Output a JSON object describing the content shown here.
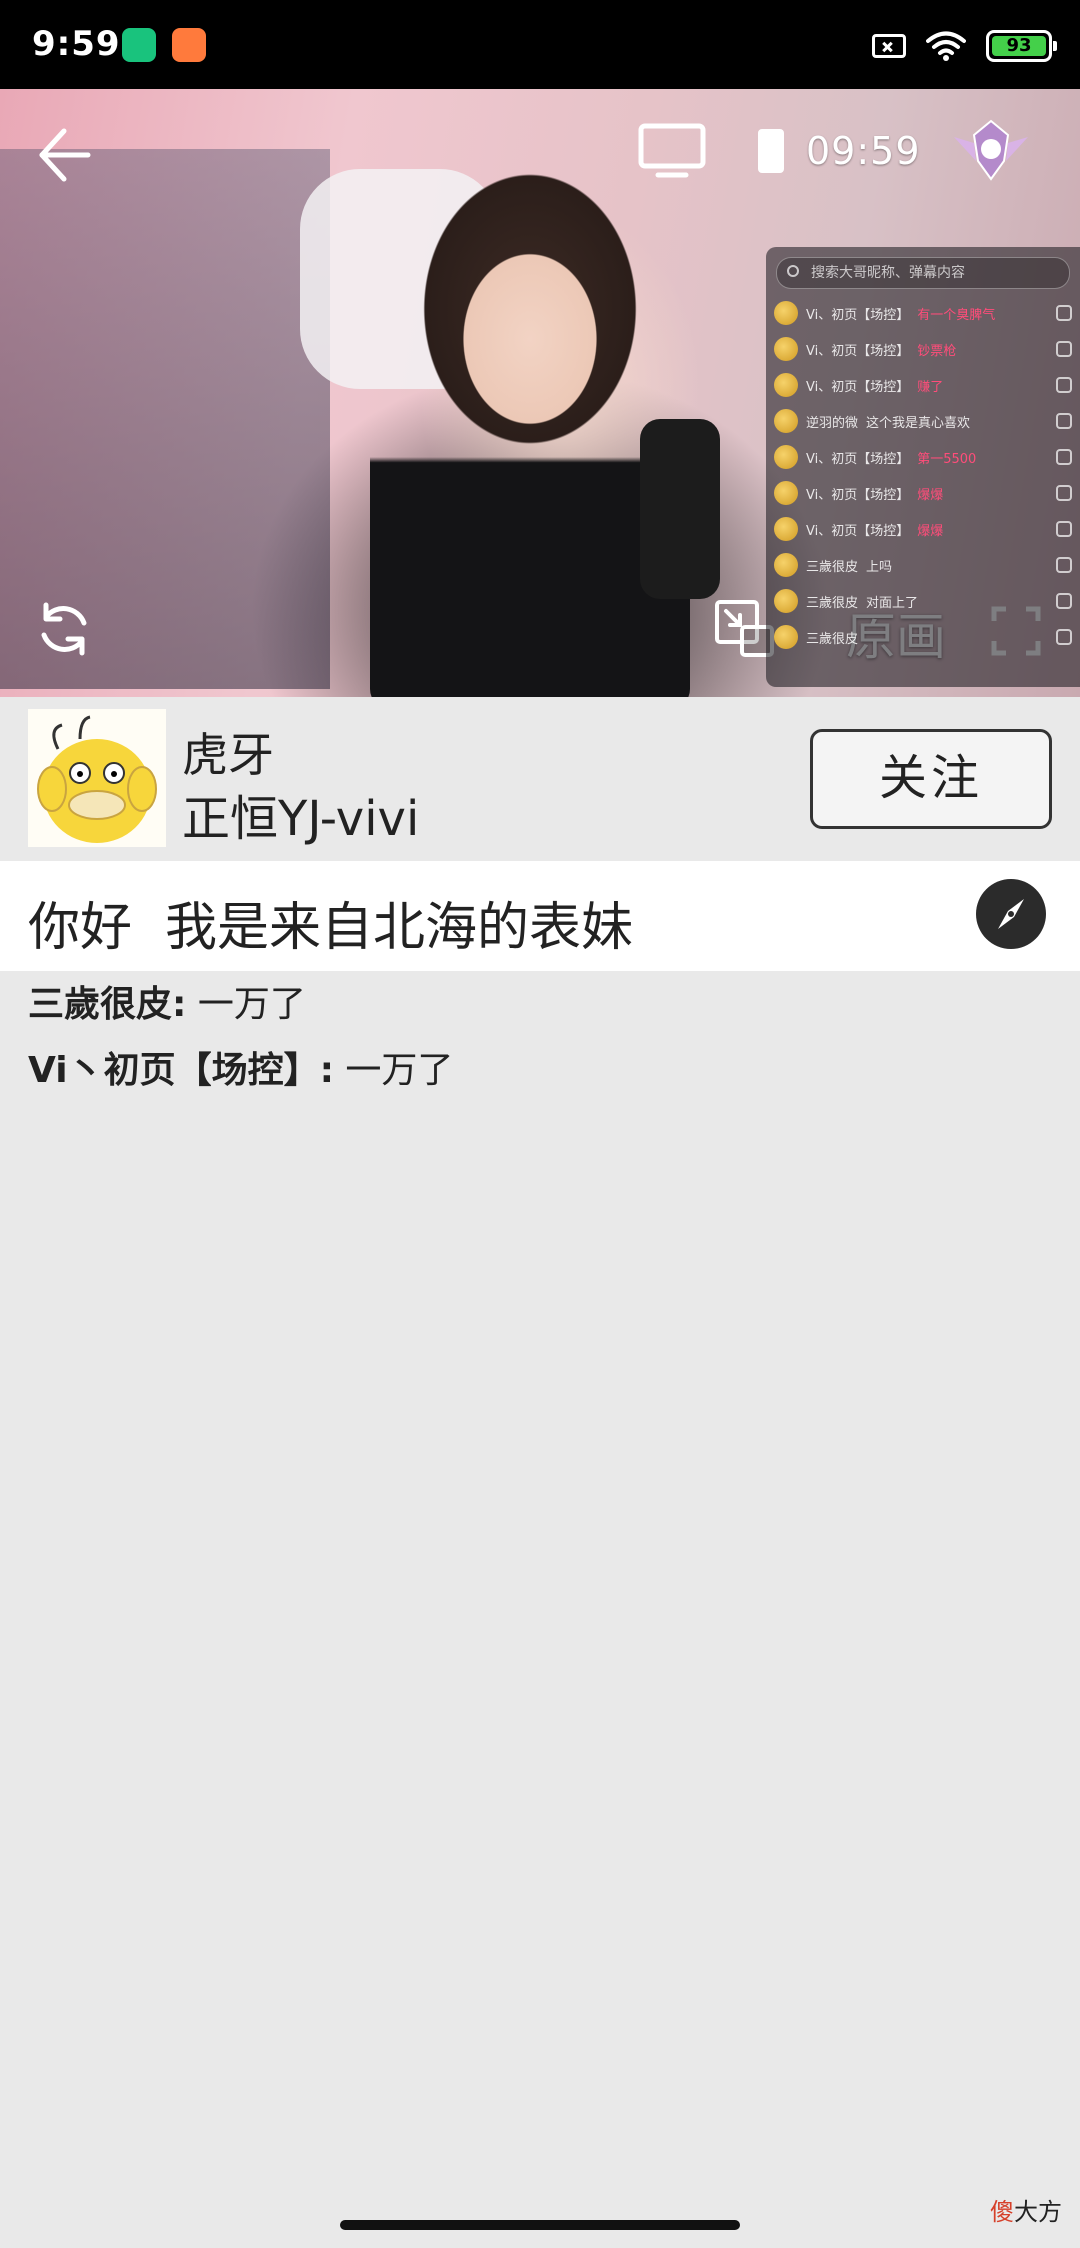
{
  "status_bar": {
    "time": "9:59",
    "battery_level": "93",
    "app_icons": [
      "shield-app-icon",
      "shop-app-icon"
    ]
  },
  "video": {
    "clock": "09:59",
    "quality_label": "原画",
    "danmaku_panel": {
      "search_placeholder": "搜索大哥昵称、弹幕内容",
      "messages": [
        {
          "user": "Vi、初页【场控】",
          "text": "有一个臭脾气",
          "style": "highlight"
        },
        {
          "user": "Vi、初页【场控】",
          "text": "钞票枪",
          "style": "highlight"
        },
        {
          "user": "Vi、初页【场控】",
          "text": "赚了",
          "style": "highlight"
        },
        {
          "user": "逆羽的微",
          "text": "这个我是真心喜欢",
          "style": "plain"
        },
        {
          "user": "Vi、初页【场控】",
          "text": "第一5500",
          "style": "highlight"
        },
        {
          "user": "Vi、初页【场控】",
          "text": "爆爆",
          "style": "highlight"
        },
        {
          "user": "Vi、初页【场控】",
          "text": "爆爆",
          "style": "highlight"
        },
        {
          "user": "三歲很皮",
          "text": "上吗",
          "style": "plain"
        },
        {
          "user": "三歲很皮",
          "text": "对面上了",
          "style": "plain"
        },
        {
          "user": "三歲很皮",
          "text": "",
          "style": "plain"
        }
      ]
    }
  },
  "streamer": {
    "platform": "虎牙",
    "name": "正恒YJ-vivi",
    "follow_label": "关注"
  },
  "room": {
    "title": "你好  我是来自北海的表妹"
  },
  "chat": [
    {
      "user": "三歲很皮:",
      "text": " 一万了"
    },
    {
      "user": "Vi丶初页【场控】:",
      "text": " 一万了"
    }
  ],
  "watermark": {
    "accent": "傻",
    "rest": "大方"
  },
  "colors": {
    "background": "#e9e9e9",
    "title_bar": "#ffffff",
    "status_bar": "#000000",
    "danmaku_highlight": "#ff4d7a",
    "battery_fill": "#44d04a"
  }
}
